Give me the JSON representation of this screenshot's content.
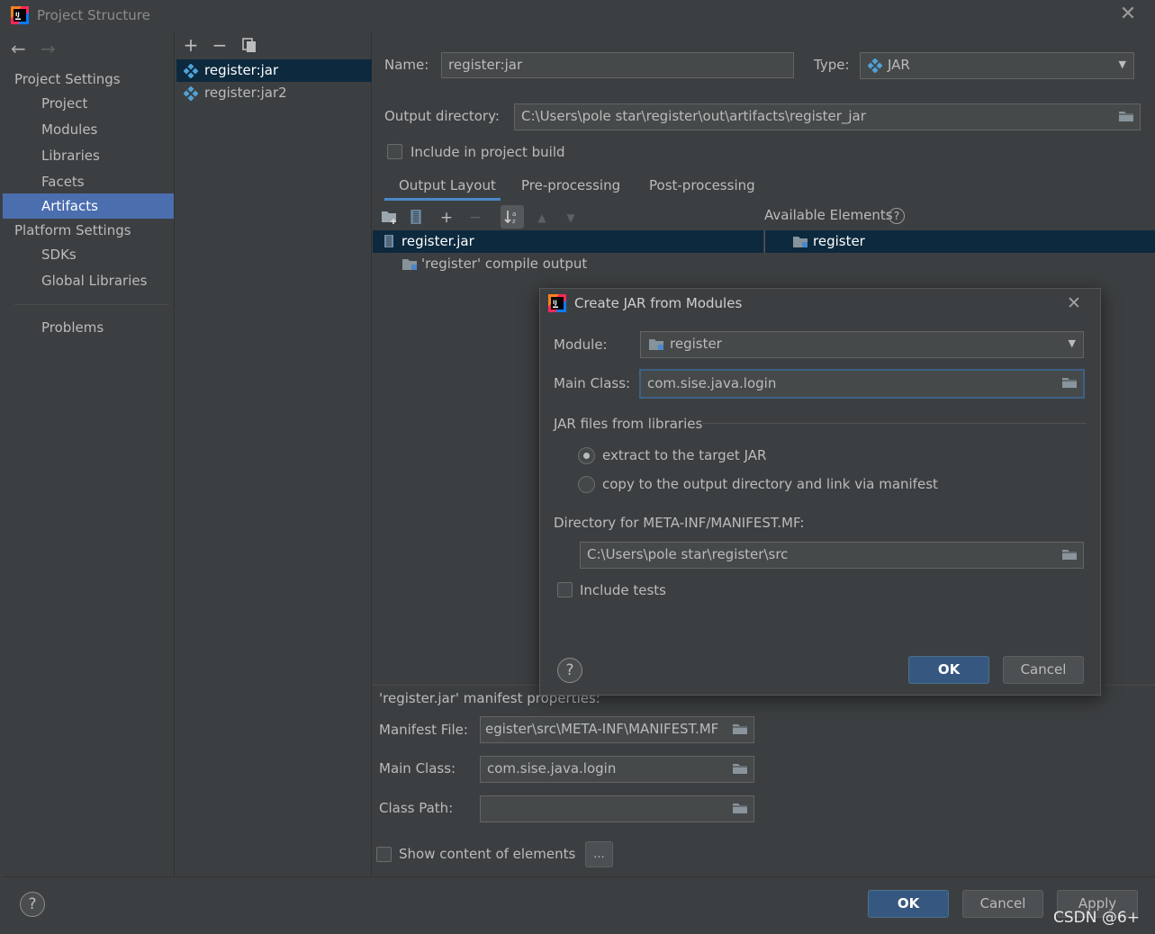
{
  "window": {
    "title": "Project Structure",
    "close_glyph": "✕"
  },
  "nav": {
    "back_glyph": "←",
    "forward_glyph": "→",
    "project_settings_header": "Project Settings",
    "items": [
      {
        "label": "Project"
      },
      {
        "label": "Modules"
      },
      {
        "label": "Libraries"
      },
      {
        "label": "Facets"
      },
      {
        "label": "Artifacts",
        "selected": true
      }
    ],
    "platform_settings_header": "Platform Settings",
    "platform_items": [
      {
        "label": "SDKs"
      },
      {
        "label": "Global Libraries"
      }
    ],
    "problems_label": "Problems"
  },
  "artifacts_toolbar": {
    "add": "+",
    "remove": "−"
  },
  "artifacts": [
    {
      "label": "register:jar",
      "selected": true
    },
    {
      "label": "register:jar2"
    }
  ],
  "artifact_form": {
    "name_label": "Name:",
    "name_value": "register:jar",
    "type_label": "Type:",
    "type_value": "JAR",
    "output_dir_label": "Output directory:",
    "output_dir_value": "C:\\Users\\pole star\\register\\out\\artifacts\\register_jar",
    "include_build_label": "Include in project build",
    "tabs": [
      {
        "label": "Output Layout",
        "active": true
      },
      {
        "label": "Pre-processing"
      },
      {
        "label": "Post-processing"
      }
    ],
    "available_elements_label": "Available Elements",
    "tree_root": "register.jar",
    "tree_child": "'register' compile output",
    "available_item": "register",
    "manifest_header": "'register.jar' manifest properties:",
    "manifest_file_label": "Manifest File:",
    "manifest_file_value": "egister\\src\\META-INF\\MANIFEST.MF",
    "main_class_label": "Main Class:",
    "main_class_value": "com.sise.java.login",
    "class_path_label": "Class Path:",
    "class_path_value": "",
    "show_content_label": "Show content of elements",
    "ellipsis_button": "..."
  },
  "bottom": {
    "help": "?",
    "ok": "OK",
    "cancel": "Cancel",
    "apply": "Apply"
  },
  "dialog": {
    "title": "Create JAR from Modules",
    "close_glyph": "✕",
    "module_label": "Module:",
    "module_value": "register",
    "main_class_label": "Main Class:",
    "main_class_value": "com.sise.java.login",
    "jar_files_header": "JAR files from libraries",
    "radio_extract": "extract to the target JAR",
    "radio_copy": "copy to the output directory and link via manifest",
    "manifest_dir_label": "Directory for META-INF/MANIFEST.MF:",
    "manifest_dir_value": "C:\\Users\\pole star\\register\\src",
    "include_tests_label": "Include tests",
    "help": "?",
    "ok": "OK",
    "cancel": "Cancel"
  },
  "watermark": "CSDN @6+",
  "colors": {
    "background": "#3c3f41",
    "selection": "#4b6eaf",
    "tree_selection": "#0d293e",
    "primary_button": "#365880",
    "accent": "#4a88c7"
  }
}
